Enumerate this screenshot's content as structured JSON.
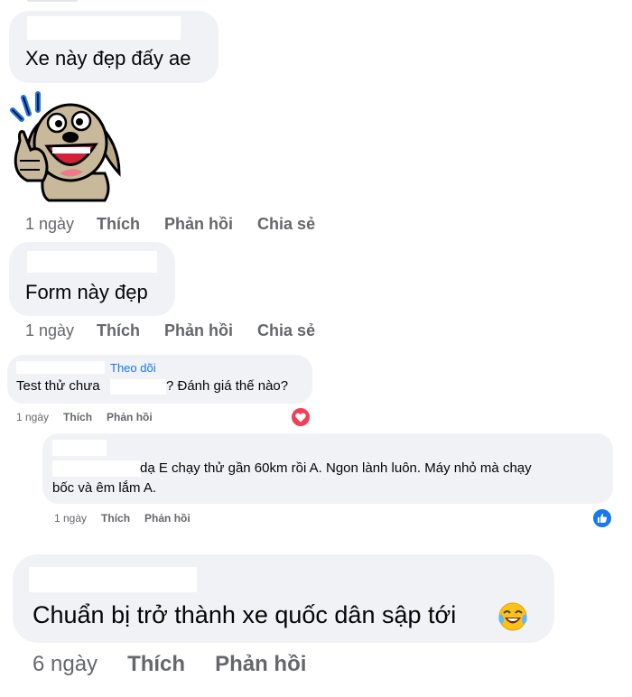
{
  "comments": [
    {
      "text": "Xe này đẹp đấy ae",
      "time": "1 ngày",
      "like": "Thích",
      "reply": "Phản hồi",
      "share": "Chia sẻ",
      "sticker_icon": "thumbs-up-dog-sticker"
    },
    {
      "text": "Form này đẹp",
      "time": "1 ngày",
      "like": "Thích",
      "reply": "Phản hồi",
      "share": "Chia sẻ"
    },
    {
      "follow": "Theo dõi",
      "text_start": "Test thử chưa",
      "text_end": "? Đánh giá thế nào?",
      "time": "1 ngày",
      "like": "Thích",
      "reply": "Phản hồi",
      "reaction_icon": "love-reaction-icon",
      "reaction_color": "#f33e58"
    },
    {
      "text_line1": "dạ E chạy thử gần 60km rồi A. Ngon lành luôn. Máy nhỏ mà chạy",
      "text_line2": "bốc và êm lắm A.",
      "time": "1 ngày",
      "like": "Thích",
      "reply": "Phản hồi",
      "reaction_icon": "like-reaction-icon",
      "reaction_color": "#1877f2"
    },
    {
      "text": "Chuẩn bị trở thành xe quốc dân sập tới",
      "emoji": "😂",
      "time": "6 ngày",
      "like": "Thích",
      "reply": "Phản hồi"
    }
  ]
}
